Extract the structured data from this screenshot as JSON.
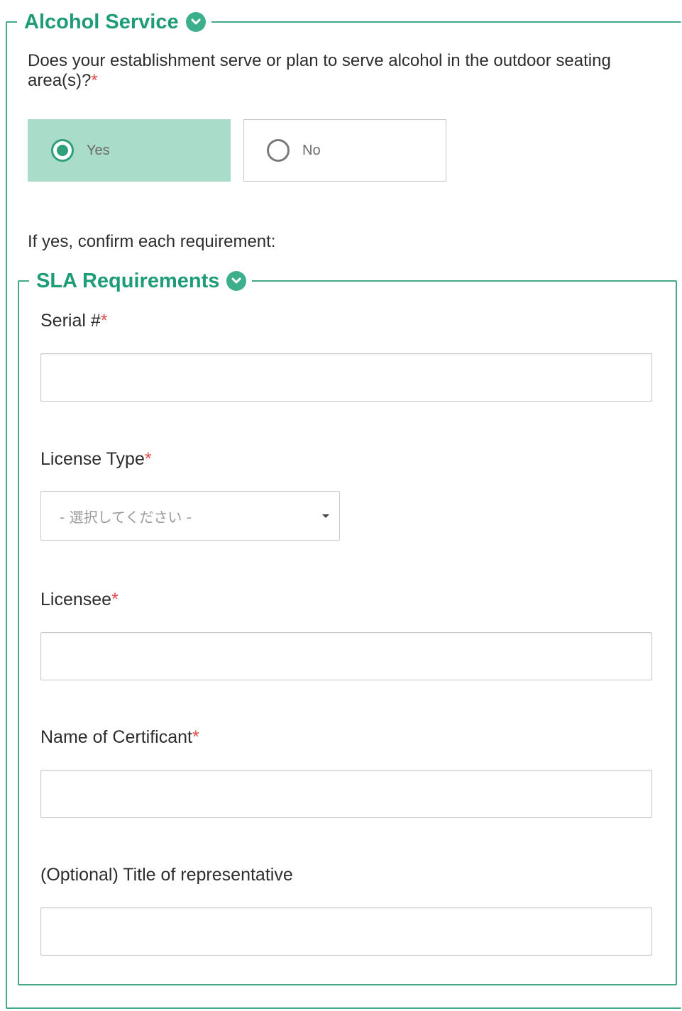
{
  "alcohol_service": {
    "legend": "Alcohol Service",
    "question": "Does your establishment serve or plan to serve alcohol in the outdoor seating area(s)?",
    "required_mark": "*",
    "options": [
      {
        "label": "Yes",
        "selected": true
      },
      {
        "label": "No",
        "selected": false
      }
    ],
    "confirm_text": "If yes, confirm each requirement:"
  },
  "sla_requirements": {
    "legend": "SLA Requirements",
    "serial": {
      "label": "Serial #",
      "required_mark": "*",
      "value": ""
    },
    "license_type": {
      "label": "License Type",
      "required_mark": "*",
      "selected": "- 選択してください -"
    },
    "licensee": {
      "label": "Licensee",
      "required_mark": "*",
      "value": ""
    },
    "certificant": {
      "label": "Name of Certificant",
      "required_mark": "*",
      "value": ""
    },
    "representative": {
      "label": "(Optional) Title of representative",
      "value": ""
    }
  },
  "colors": {
    "accent": "#1e9b77",
    "border": "#43a98a",
    "selected_bg": "#a9dcc9",
    "required": "#e04848"
  }
}
